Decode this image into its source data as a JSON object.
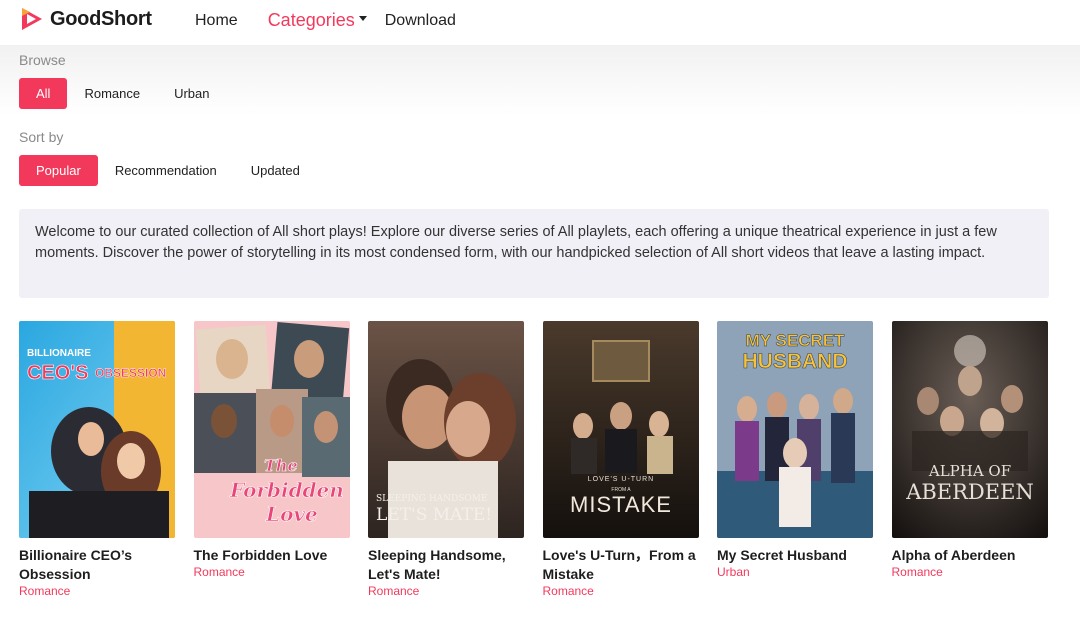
{
  "brand": {
    "name": "GoodShort",
    "accent": "#f2395c"
  },
  "nav": {
    "home": "Home",
    "categories": "Categories",
    "download": "Download"
  },
  "browse": {
    "label": "Browse",
    "options": [
      "All",
      "Romance",
      "Urban"
    ],
    "selected": "All"
  },
  "sort": {
    "label": "Sort by",
    "options": [
      "Popular",
      "Recommendation",
      "Updated"
    ],
    "selected": "Popular"
  },
  "description": "Welcome to our curated collection of All short plays! Explore our diverse series of All playlets, each offering a unique theatrical experience in just a few moments. Discover the power of storytelling in its most condensed form, with our handpicked selection of All short videos that leave a lasting impact.",
  "cards": [
    {
      "title": "Billionaire CEO’s Obsession",
      "tag": "Romance",
      "poster_text": [
        "BILLIONAIRE",
        "CEO'S",
        "OBSESSION"
      ]
    },
    {
      "title": "The Forbidden Love",
      "tag": "Romance",
      "poster_text": [
        "The",
        "Forbidden",
        "Love"
      ]
    },
    {
      "title": "Sleeping Handsome, Let's Mate!",
      "tag": "Romance",
      "poster_text": [
        "SLEEPING HANDSOME",
        "LET'S MATE!"
      ]
    },
    {
      "title": "Love's U-Turn，From a Mistake",
      "tag": "Romance",
      "poster_text": [
        "LOVE'S U-TURN",
        "FROM A",
        "MISTAKE"
      ]
    },
    {
      "title": "My Secret Husband",
      "tag": "Urban",
      "poster_text": [
        "MY SECRET",
        "HUSBAND"
      ]
    },
    {
      "title": "Alpha of Aberdeen",
      "tag": "Romance",
      "poster_text": [
        "ALPHA OF",
        "ABERDEEN"
      ]
    }
  ]
}
